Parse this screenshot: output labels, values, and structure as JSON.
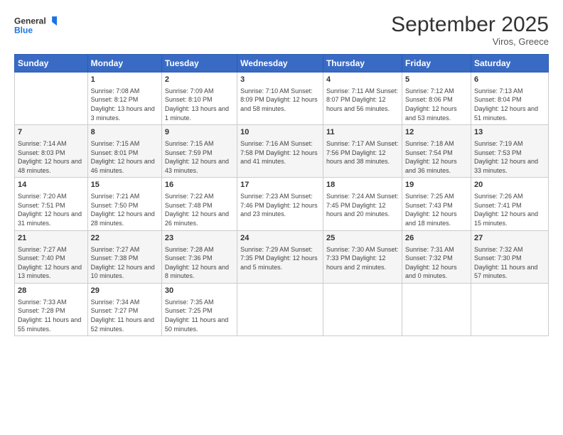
{
  "logo": {
    "line1": "General",
    "line2": "Blue"
  },
  "title": "September 2025",
  "location": "Viros, Greece",
  "days_of_week": [
    "Sunday",
    "Monday",
    "Tuesday",
    "Wednesday",
    "Thursday",
    "Friday",
    "Saturday"
  ],
  "weeks": [
    [
      {
        "day": "",
        "data": ""
      },
      {
        "day": "1",
        "data": "Sunrise: 7:08 AM\nSunset: 8:12 PM\nDaylight: 13 hours\nand 3 minutes."
      },
      {
        "day": "2",
        "data": "Sunrise: 7:09 AM\nSunset: 8:10 PM\nDaylight: 13 hours\nand 1 minute."
      },
      {
        "day": "3",
        "data": "Sunrise: 7:10 AM\nSunset: 8:09 PM\nDaylight: 12 hours\nand 58 minutes."
      },
      {
        "day": "4",
        "data": "Sunrise: 7:11 AM\nSunset: 8:07 PM\nDaylight: 12 hours\nand 56 minutes."
      },
      {
        "day": "5",
        "data": "Sunrise: 7:12 AM\nSunset: 8:06 PM\nDaylight: 12 hours\nand 53 minutes."
      },
      {
        "day": "6",
        "data": "Sunrise: 7:13 AM\nSunset: 8:04 PM\nDaylight: 12 hours\nand 51 minutes."
      }
    ],
    [
      {
        "day": "7",
        "data": "Sunrise: 7:14 AM\nSunset: 8:03 PM\nDaylight: 12 hours\nand 48 minutes."
      },
      {
        "day": "8",
        "data": "Sunrise: 7:15 AM\nSunset: 8:01 PM\nDaylight: 12 hours\nand 46 minutes."
      },
      {
        "day": "9",
        "data": "Sunrise: 7:15 AM\nSunset: 7:59 PM\nDaylight: 12 hours\nand 43 minutes."
      },
      {
        "day": "10",
        "data": "Sunrise: 7:16 AM\nSunset: 7:58 PM\nDaylight: 12 hours\nand 41 minutes."
      },
      {
        "day": "11",
        "data": "Sunrise: 7:17 AM\nSunset: 7:56 PM\nDaylight: 12 hours\nand 38 minutes."
      },
      {
        "day": "12",
        "data": "Sunrise: 7:18 AM\nSunset: 7:54 PM\nDaylight: 12 hours\nand 36 minutes."
      },
      {
        "day": "13",
        "data": "Sunrise: 7:19 AM\nSunset: 7:53 PM\nDaylight: 12 hours\nand 33 minutes."
      }
    ],
    [
      {
        "day": "14",
        "data": "Sunrise: 7:20 AM\nSunset: 7:51 PM\nDaylight: 12 hours\nand 31 minutes."
      },
      {
        "day": "15",
        "data": "Sunrise: 7:21 AM\nSunset: 7:50 PM\nDaylight: 12 hours\nand 28 minutes."
      },
      {
        "day": "16",
        "data": "Sunrise: 7:22 AM\nSunset: 7:48 PM\nDaylight: 12 hours\nand 26 minutes."
      },
      {
        "day": "17",
        "data": "Sunrise: 7:23 AM\nSunset: 7:46 PM\nDaylight: 12 hours\nand 23 minutes."
      },
      {
        "day": "18",
        "data": "Sunrise: 7:24 AM\nSunset: 7:45 PM\nDaylight: 12 hours\nand 20 minutes."
      },
      {
        "day": "19",
        "data": "Sunrise: 7:25 AM\nSunset: 7:43 PM\nDaylight: 12 hours\nand 18 minutes."
      },
      {
        "day": "20",
        "data": "Sunrise: 7:26 AM\nSunset: 7:41 PM\nDaylight: 12 hours\nand 15 minutes."
      }
    ],
    [
      {
        "day": "21",
        "data": "Sunrise: 7:27 AM\nSunset: 7:40 PM\nDaylight: 12 hours\nand 13 minutes."
      },
      {
        "day": "22",
        "data": "Sunrise: 7:27 AM\nSunset: 7:38 PM\nDaylight: 12 hours\nand 10 minutes."
      },
      {
        "day": "23",
        "data": "Sunrise: 7:28 AM\nSunset: 7:36 PM\nDaylight: 12 hours\nand 8 minutes."
      },
      {
        "day": "24",
        "data": "Sunrise: 7:29 AM\nSunset: 7:35 PM\nDaylight: 12 hours\nand 5 minutes."
      },
      {
        "day": "25",
        "data": "Sunrise: 7:30 AM\nSunset: 7:33 PM\nDaylight: 12 hours\nand 2 minutes."
      },
      {
        "day": "26",
        "data": "Sunrise: 7:31 AM\nSunset: 7:32 PM\nDaylight: 12 hours\nand 0 minutes."
      },
      {
        "day": "27",
        "data": "Sunrise: 7:32 AM\nSunset: 7:30 PM\nDaylight: 11 hours\nand 57 minutes."
      }
    ],
    [
      {
        "day": "28",
        "data": "Sunrise: 7:33 AM\nSunset: 7:28 PM\nDaylight: 11 hours\nand 55 minutes."
      },
      {
        "day": "29",
        "data": "Sunrise: 7:34 AM\nSunset: 7:27 PM\nDaylight: 11 hours\nand 52 minutes."
      },
      {
        "day": "30",
        "data": "Sunrise: 7:35 AM\nSunset: 7:25 PM\nDaylight: 11 hours\nand 50 minutes."
      },
      {
        "day": "",
        "data": ""
      },
      {
        "day": "",
        "data": ""
      },
      {
        "day": "",
        "data": ""
      },
      {
        "day": "",
        "data": ""
      }
    ]
  ]
}
